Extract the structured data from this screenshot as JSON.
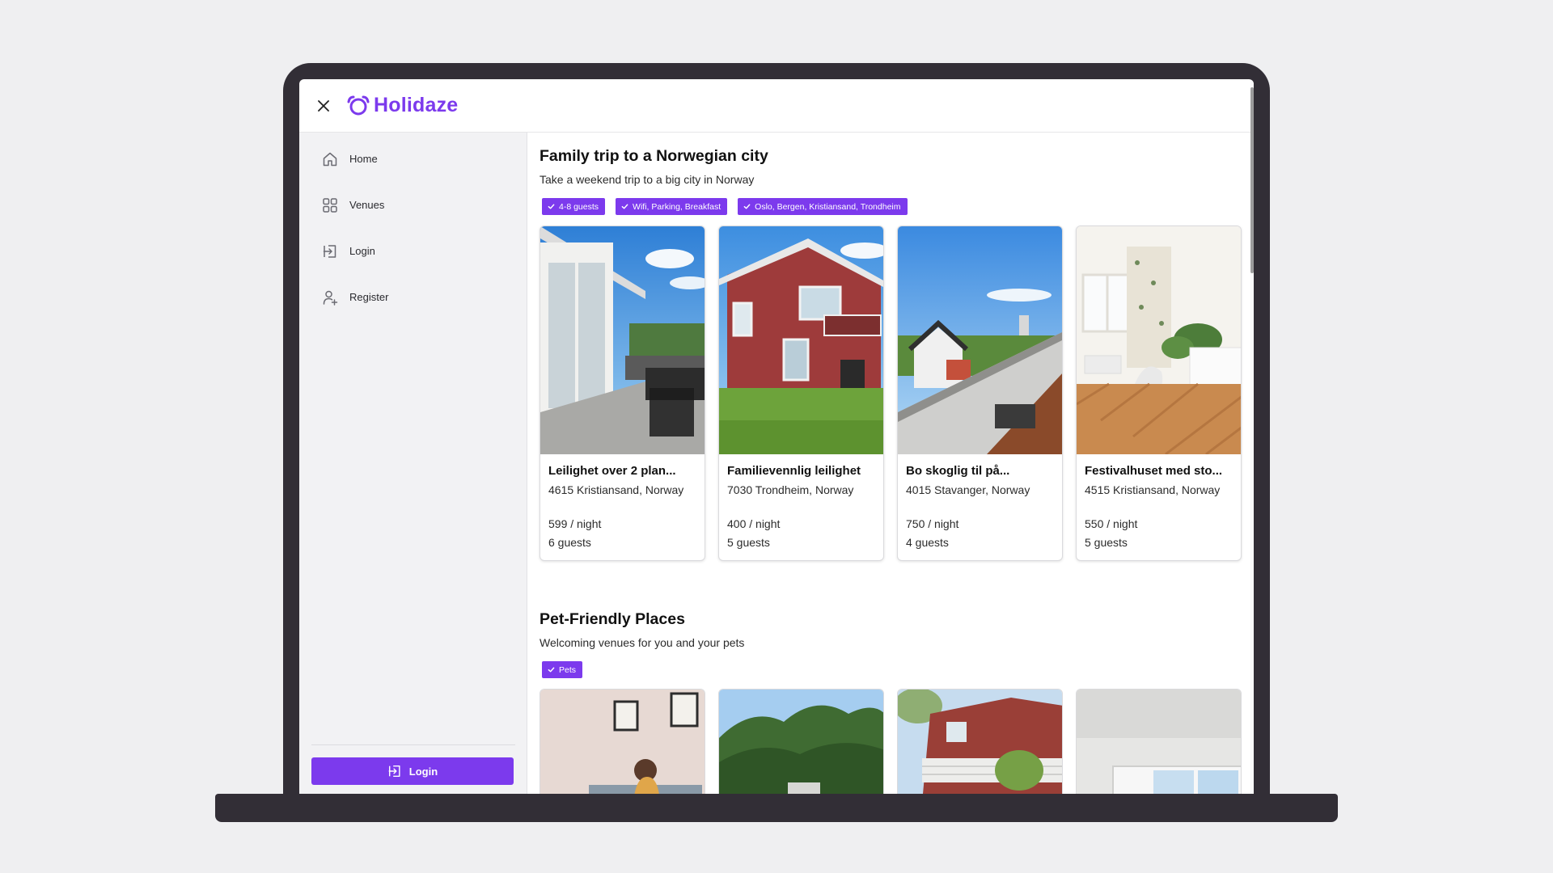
{
  "brand": {
    "name": "Holidaze",
    "accent": "#7c3aed",
    "frame": "#322e36"
  },
  "topbar": {
    "close_icon": "close-icon"
  },
  "sidebar": {
    "items": [
      {
        "label": "Home",
        "icon": "home-icon"
      },
      {
        "label": "Venues",
        "icon": "grid-icon"
      },
      {
        "label": "Login",
        "icon": "login-icon"
      },
      {
        "label": "Register",
        "icon": "user-plus-icon"
      }
    ],
    "login_button": "Login"
  },
  "sections": [
    {
      "title": "Family trip to a Norwegian city",
      "subtitle": "Take a weekend trip to a big city in Norway",
      "tags": [
        "4-8 guests",
        "Wifi, Parking, Breakfast",
        "Oslo, Bergen, Kristiansand, Trondheim"
      ],
      "cards": [
        {
          "title": "Leilighet over 2 plan...",
          "location": "4615 Kristiansand, Norway",
          "price": "599 / night",
          "guests": "6 guests"
        },
        {
          "title": "Familievennlig leilighet",
          "location": "7030 Trondheim, Norway",
          "price": "400 / night",
          "guests": "5 guests"
        },
        {
          "title": "Bo skoglig til på...",
          "location": "4015 Stavanger, Norway",
          "price": "750 / night",
          "guests": "4 guests"
        },
        {
          "title": "Festivalhuset med sto...",
          "location": "4515 Kristiansand, Norway",
          "price": "550 / night",
          "guests": "5 guests"
        }
      ]
    },
    {
      "title": "Pet-Friendly Places",
      "subtitle": "Welcoming venues for you and your pets",
      "tags": [
        "Pets"
      ]
    }
  ]
}
